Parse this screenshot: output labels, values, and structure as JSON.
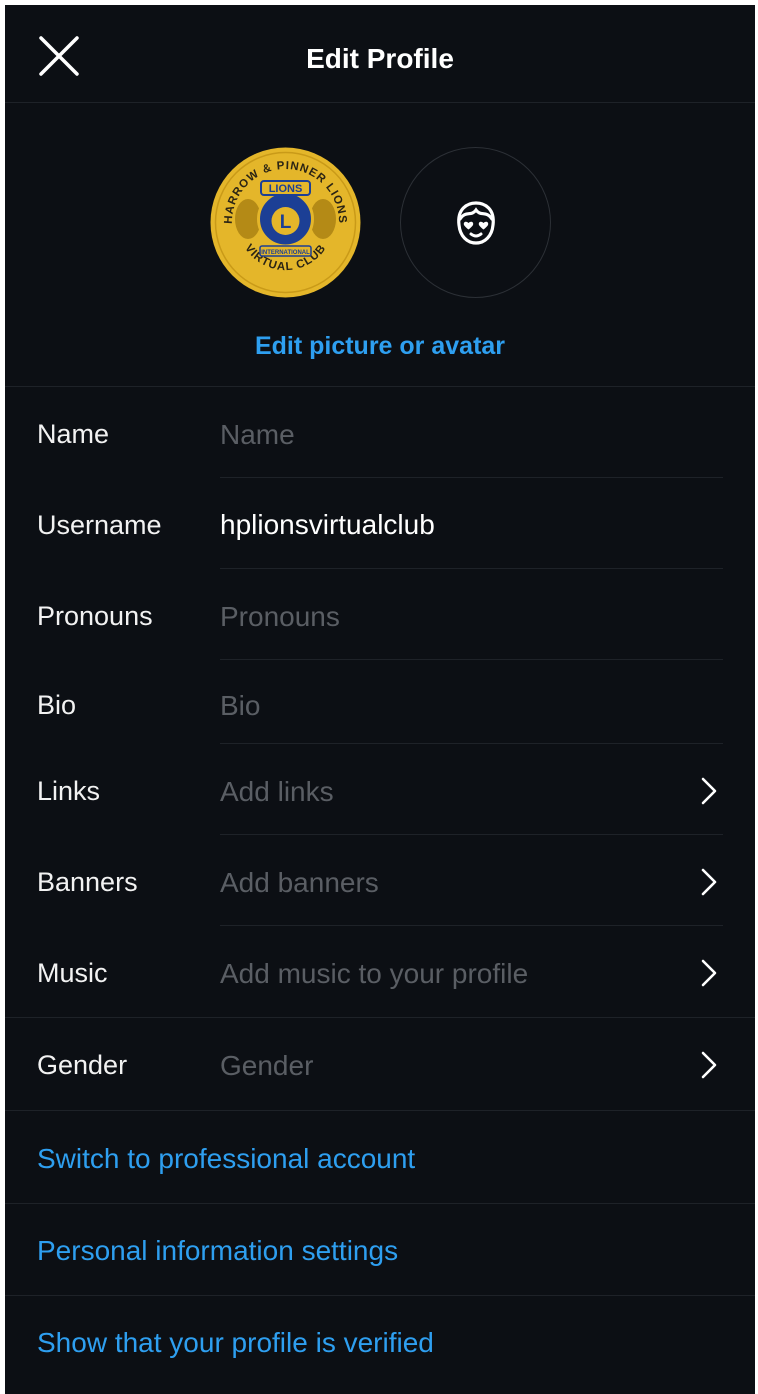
{
  "header": {
    "title": "Edit Profile",
    "close_icon": "close-icon"
  },
  "profile": {
    "logo_text_top": "HARROW & PINNER LIONS",
    "logo_text_bottom": "VIRTUAL CLUB",
    "logo_banner": "LIONS",
    "logo_letter": "L",
    "logo_ribbon": "INTERNATIONAL",
    "logo_color": "#e4b62a",
    "avatar_icon": "avatar-face-icon",
    "edit_link": "Edit picture or avatar"
  },
  "fields": [
    {
      "label": "Name",
      "value": "",
      "placeholder": "Name"
    },
    {
      "label": "Username",
      "value": "hplionsvirtualclub",
      "placeholder": ""
    },
    {
      "label": "Pronouns",
      "value": "",
      "placeholder": "Pronouns"
    },
    {
      "label": "Bio",
      "value": "",
      "placeholder": "Bio"
    },
    {
      "label": "Links",
      "value": "",
      "placeholder": "Add links"
    },
    {
      "label": "Banners",
      "value": "",
      "placeholder": "Add banners"
    },
    {
      "label": "Music",
      "value": "",
      "placeholder": "Add music to your profile"
    },
    {
      "label": "Gender",
      "value": "",
      "placeholder": "Gender"
    }
  ],
  "links": {
    "professional": "Switch to professional account",
    "personal_info": "Personal information settings",
    "verified": "Show that your profile is verified"
  },
  "colors": {
    "background": "#0c0f14",
    "accent": "#2e9ff0",
    "placeholder": "#5a5e64",
    "divider": "#1e2228"
  }
}
